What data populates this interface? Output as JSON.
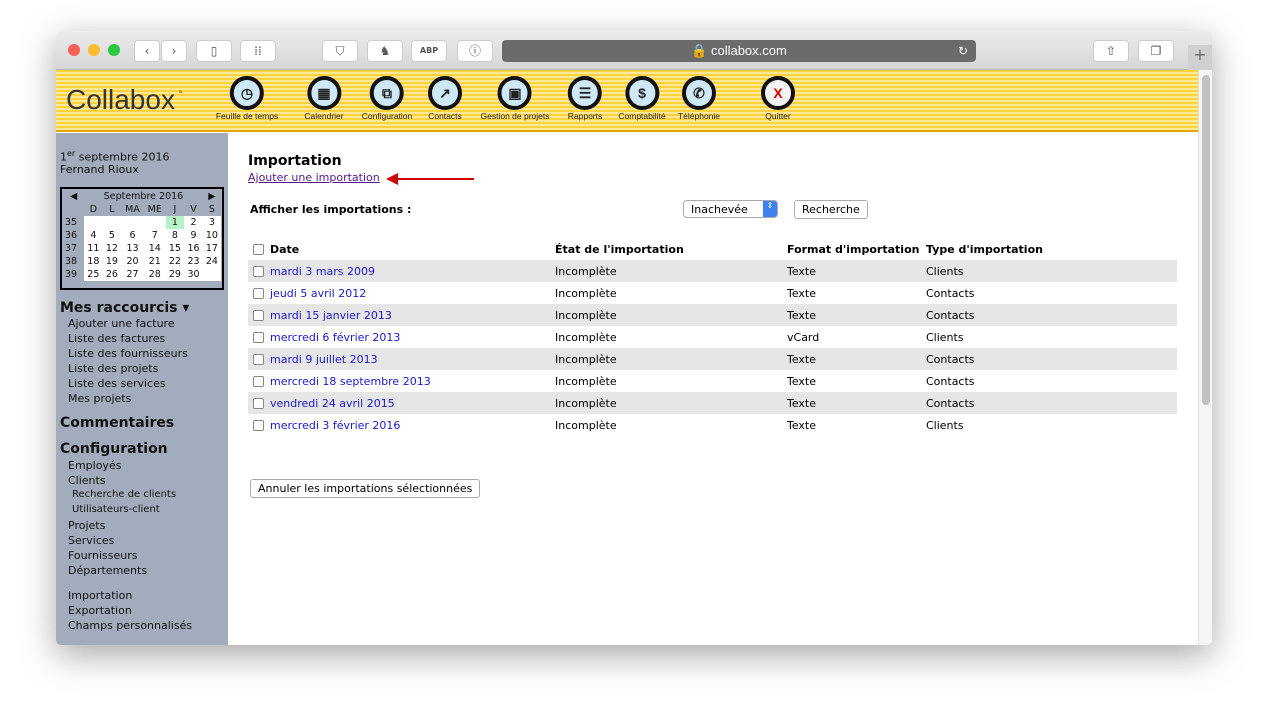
{
  "browser": {
    "url": "collabox.com",
    "toolbar_icons": [
      "back-icon",
      "forward-icon",
      "sidebar-icon",
      "grid-icon",
      "pocket-icon",
      "evernote-icon",
      "adblock-icon",
      "1password-icon",
      "share-icon",
      "tabs-icon",
      "new-tab-icon"
    ],
    "abp": "ABP"
  },
  "app": {
    "logo": "Collabox",
    "nav": [
      {
        "label": "Feuille de temps",
        "icon": "clock-icon",
        "glyph": "◷"
      },
      {
        "label": "Calendrier",
        "icon": "calendar-icon",
        "glyph": "▦"
      },
      {
        "label": "Configuration",
        "icon": "configuration-icon",
        "glyph": "⧉"
      },
      {
        "label": "Contacts",
        "icon": "chart-icon",
        "glyph": "↗"
      },
      {
        "label": "Gestion de projets",
        "icon": "projects-icon",
        "glyph": "▣"
      },
      {
        "label": "Rapports",
        "icon": "report-icon",
        "glyph": "☰"
      },
      {
        "label": "Comptabilité",
        "icon": "dollar-icon",
        "glyph": "$"
      },
      {
        "label": "Téléphonie",
        "icon": "phone-icon",
        "glyph": "✆"
      },
      {
        "label": "Quitter",
        "icon": "quit-icon",
        "glyph": "X"
      }
    ]
  },
  "sidebar": {
    "date_sup": "er",
    "date_day": "1",
    "date_rest": " septembre 2016",
    "user": "Fernand Rioux",
    "calendar": {
      "month": "Septembre 2016",
      "days": [
        "D",
        "L",
        "MA",
        "ME",
        "J",
        "V",
        "S"
      ],
      "weeks": [
        {
          "wk": "35",
          "d": [
            "",
            "",
            "",
            "",
            "1",
            "2",
            "3"
          ]
        },
        {
          "wk": "36",
          "d": [
            "4",
            "5",
            "6",
            "7",
            "8",
            "9",
            "10"
          ]
        },
        {
          "wk": "37",
          "d": [
            "11",
            "12",
            "13",
            "14",
            "15",
            "16",
            "17"
          ]
        },
        {
          "wk": "38",
          "d": [
            "18",
            "19",
            "20",
            "21",
            "22",
            "23",
            "24"
          ]
        },
        {
          "wk": "39",
          "d": [
            "25",
            "26",
            "27",
            "28",
            "29",
            "30",
            ""
          ]
        }
      ]
    },
    "shortcuts_title": "Mes raccourcis ▾",
    "shortcuts": [
      "Ajouter une facture",
      "Liste des factures",
      "Liste des fournisseurs",
      "Liste des projets",
      "Liste des services",
      "Mes projets"
    ],
    "comments": "Commentaires",
    "config_title": "Configuration",
    "config": [
      "Employés",
      "Clients"
    ],
    "config_sub": [
      "Recherche de clients",
      "Utilisateurs-client"
    ],
    "config2": [
      "Projets",
      "Services",
      "Fournisseurs",
      "Départements"
    ],
    "config3": [
      "Importation",
      "Exportation",
      "Champs personnalisés"
    ]
  },
  "main": {
    "title": "Importation",
    "add_link": "Ajouter une importation",
    "filter_label": "Afficher les importations :",
    "filter_value": "Inachevée",
    "search_btn": "Recherche",
    "columns": [
      "Date",
      "État de l'importation",
      "Format d'importation",
      "Type d'importation"
    ],
    "rows": [
      [
        "mardi 3 mars 2009",
        "Incomplète",
        "Texte",
        "Clients"
      ],
      [
        "jeudi 5 avril 2012",
        "Incomplète",
        "Texte",
        "Contacts"
      ],
      [
        "mardi 15 janvier 2013",
        "Incomplète",
        "Texte",
        "Contacts"
      ],
      [
        "mercredi 6 février 2013",
        "Incomplète",
        "vCard",
        "Clients"
      ],
      [
        "mardi 9 juillet 2013",
        "Incomplète",
        "Texte",
        "Contacts"
      ],
      [
        "mercredi 18 septembre 2013",
        "Incomplète",
        "Texte",
        "Contacts"
      ],
      [
        "vendredi 24 avril 2015",
        "Incomplète",
        "Texte",
        "Contacts"
      ],
      [
        "mercredi 3 février 2016",
        "Incomplète",
        "Texte",
        "Clients"
      ]
    ],
    "cancel_btn": "Annuler les importations sélectionnées"
  },
  "colors": {
    "accent_arrow": "#cc0000",
    "link": "#1a1acc",
    "sidebar": "#a3acbd",
    "today": "#b8f0c8"
  }
}
